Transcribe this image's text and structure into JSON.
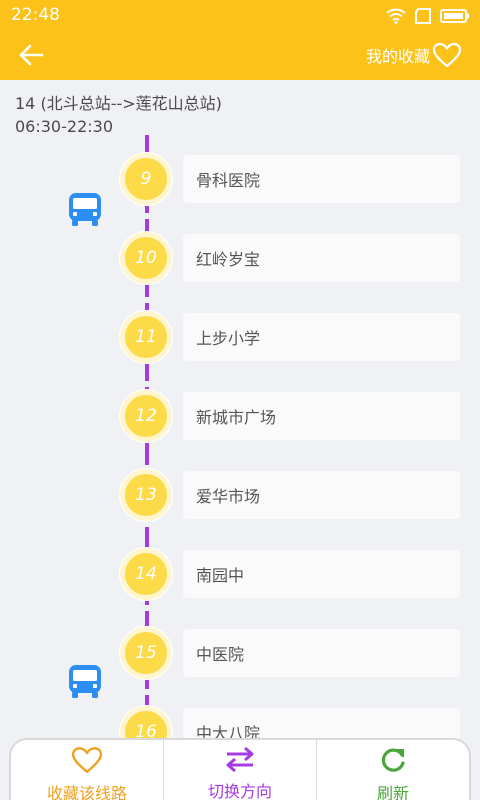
{
  "statusbar": {
    "time": "22:48"
  },
  "header": {
    "favorites_label": "我的收藏"
  },
  "route": {
    "name": "14 (北斗总站-->莲花山总站)",
    "hours": "06:30-22:30"
  },
  "stops": [
    {
      "index": "9",
      "name": "骨科医院"
    },
    {
      "index": "10",
      "name": "红岭岁宝"
    },
    {
      "index": "11",
      "name": "上步小学"
    },
    {
      "index": "12",
      "name": "新城市广场"
    },
    {
      "index": "13",
      "name": "爱华市场"
    },
    {
      "index": "14",
      "name": "南园中"
    },
    {
      "index": "15",
      "name": "中医院"
    },
    {
      "index": "16",
      "name": "中大八院"
    }
  ],
  "bottom": {
    "favorite_label": "收藏该线路",
    "switch_label": "切换方向",
    "refresh_label": "刷新"
  },
  "colors": {
    "primary": "#fdc21a",
    "track": "#a63be0",
    "stop_circle": "#fdda47",
    "bus": "#2b8ef0",
    "favorite": "#f0a020",
    "switch": "#a63be0",
    "refresh": "#4aa63a"
  },
  "icons": [
    "back-arrow-icon",
    "heart-icon",
    "bus-icon",
    "swap-arrows-icon",
    "refresh-icon"
  ]
}
